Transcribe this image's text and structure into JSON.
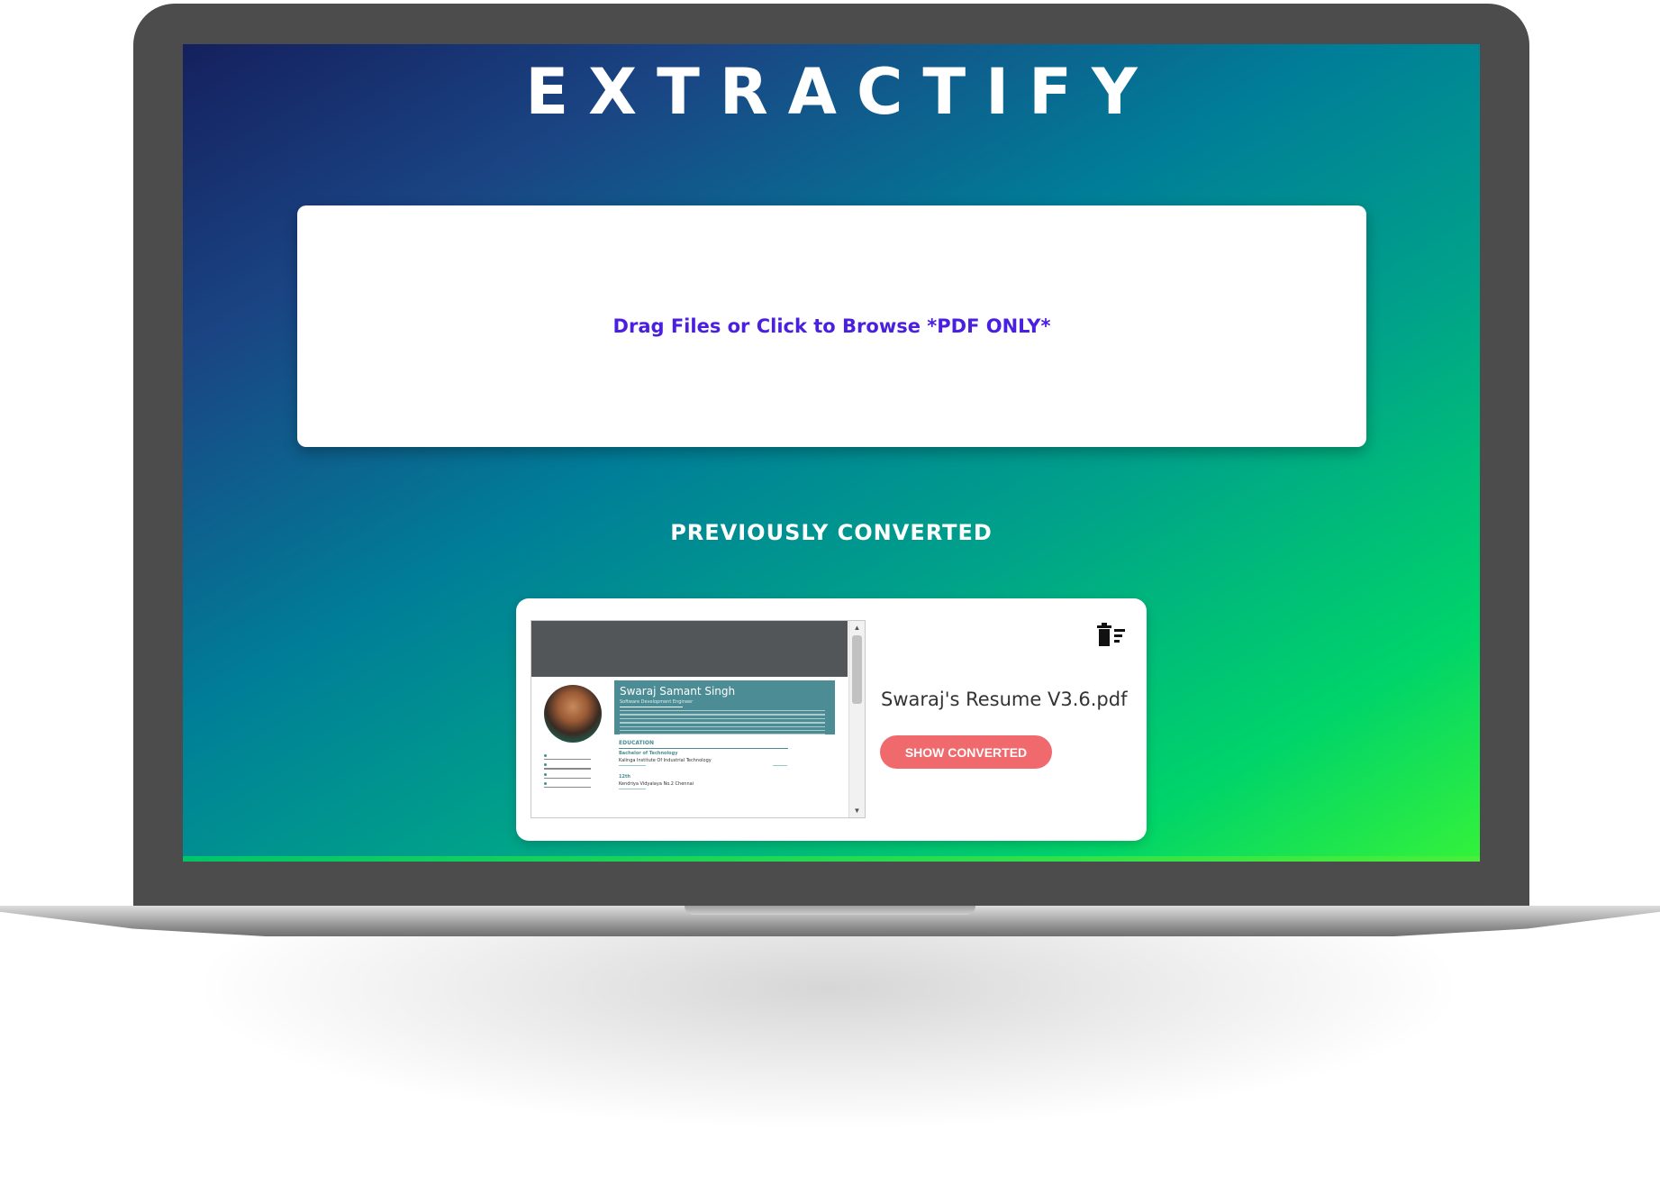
{
  "app": {
    "title": "EXTRACTIFY"
  },
  "upload": {
    "prompt": "Drag Files or Click to Browse *PDF ONLY*"
  },
  "history": {
    "heading": "PREVIOUSLY CONVERTED",
    "items": [
      {
        "file_name": "Swaraj's Resume V3.6.pdf",
        "action_label": "SHOW CONVERTED",
        "delete_icon": "trash-icon",
        "preview": {
          "name": "Swaraj Samant Singh",
          "role": "Software Development Engineer",
          "section": "EDUCATION",
          "degree": "Bachelor of Technology",
          "school": "Kalinga Institute Of Industrial Technology",
          "degree2": "12th",
          "school2": "Kendriya Vidyalaya No.2 Chennai"
        }
      }
    ]
  },
  "colors": {
    "accent_text": "#4b1fe0",
    "button": "#f06a6d",
    "gradient_start": "#15205e",
    "gradient_end": "#34f23a"
  }
}
